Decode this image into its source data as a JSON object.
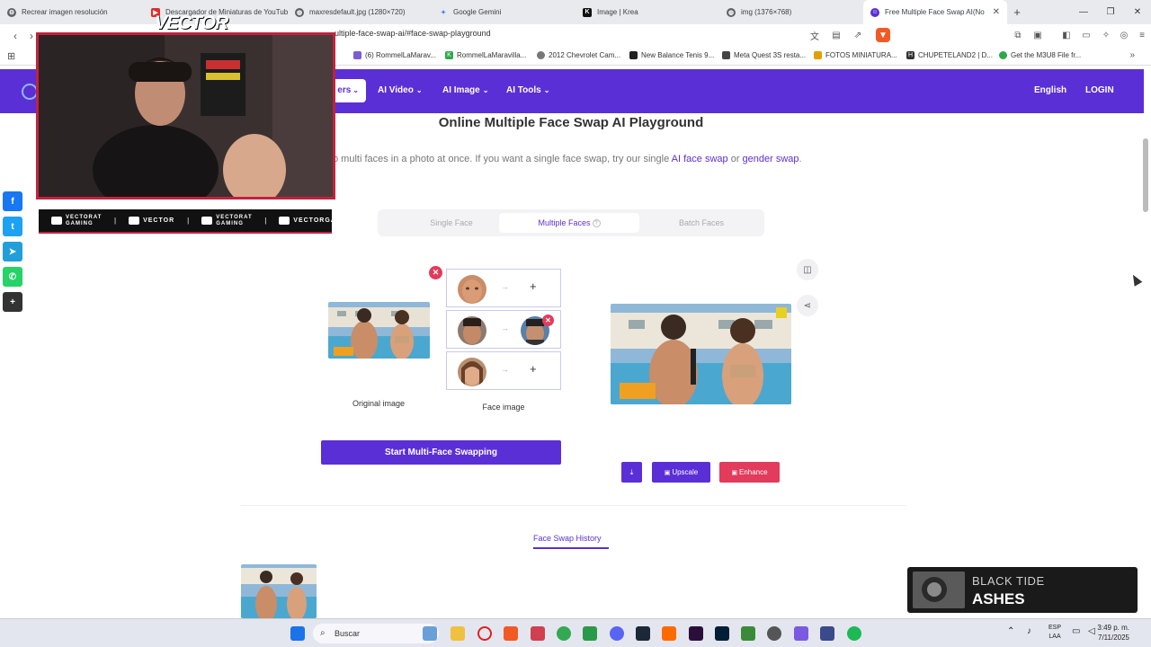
{
  "browser": {
    "tabs": [
      {
        "label": "Recrear imagen resolución",
        "icon": "gear-icon",
        "color": "#5f6368"
      },
      {
        "label": "Descargador de Miniaturas de YouTube",
        "icon": "youtube-icon",
        "color": "#e02b2b"
      },
      {
        "label": "maxresdefault.jpg (1280×720)",
        "icon": "globe-icon",
        "color": "#5f6368"
      },
      {
        "label": "Google Gemini",
        "icon": "gemini-icon",
        "color": "#4a7cf0"
      },
      {
        "label": "Image | Krea",
        "icon": "krea-icon",
        "color": "#111111"
      },
      {
        "label": "img (1376×768)",
        "icon": "globe-icon",
        "color": "#5f6368"
      },
      {
        "label": "Free Multiple Face Swap AI(No Login)",
        "icon": "face-swap-icon",
        "color": "#5b2fd6",
        "active": true
      }
    ],
    "url": "ultiple-face-swap-ai/#face-swap-playground",
    "bookmarks": [
      {
        "label": "(6) RommelLaMarav...",
        "color": "#7b5cd6"
      },
      {
        "label": "RommelLaMaravilla...",
        "color": "#2da84a"
      },
      {
        "label": "2012 Chevrolet Cam...",
        "color": "#777777"
      },
      {
        "label": "New Balance Tenis 9...",
        "color": "#222222"
      },
      {
        "label": "Meta Quest 3S resta...",
        "color": "#444444"
      },
      {
        "label": "FOTOS MINIATURA...",
        "color": "#e0a100"
      },
      {
        "label": "CHUPETELAND2 | D...",
        "color": "#333333"
      },
      {
        "label": "Get the M3U8 File fr...",
        "color": "#2da84a"
      }
    ]
  },
  "header": {
    "active_menu": "ers",
    "menu": [
      "AI Video",
      "AI Image",
      "AI Tools"
    ],
    "language": "English",
    "login": "LOGIN",
    "color": "#5b2fd6"
  },
  "main": {
    "title": "Online Multiple Face Swap AI Playground",
    "subtitle_prefix": "o multi faces in a photo at once. If you want a single face swap, try our single ",
    "link_face_swap": "AI face swap",
    "subtitle_or": " or ",
    "link_gender_swap": "gender swap",
    "subtitle_end": ".",
    "tabs": {
      "single": "Single Face",
      "multiple": "Multiple Faces",
      "batch": "Batch Faces"
    },
    "original_caption": "Original image",
    "face_caption": "Face image",
    "start_button": "Start Multi-Face Swapping",
    "upscale": "Upscale",
    "enhance": "Enhance",
    "history_tab": "Face Swap History"
  },
  "overlay": {
    "streamer": "VECTOR",
    "socials": [
      {
        "icon": "youtube-icon",
        "label": "VECTORAT GAMING"
      },
      {
        "icon": "twitch-icon",
        "label": "VECTOR"
      },
      {
        "icon": "twitter-icon",
        "label": "VECTORAT GAMING"
      },
      {
        "icon": "instagram-icon",
        "label": "VECTORGA"
      }
    ],
    "music_band": "BLACK TIDE",
    "music_song": "ASHES"
  },
  "share_bar": [
    {
      "icon": "facebook-icon",
      "color": "#1877f2"
    },
    {
      "icon": "twitter-icon",
      "color": "#1da1f2"
    },
    {
      "icon": "telegram-icon",
      "color": "#229ed9"
    },
    {
      "icon": "whatsapp-icon",
      "color": "#25d366"
    },
    {
      "icon": "plus-icon",
      "color": "#333333"
    }
  ],
  "taskbar": {
    "search": "Buscar",
    "lang_top": "ESP",
    "lang_bottom": "LAA",
    "time": "3:49 p. m.",
    "date": "7/11/2025"
  }
}
